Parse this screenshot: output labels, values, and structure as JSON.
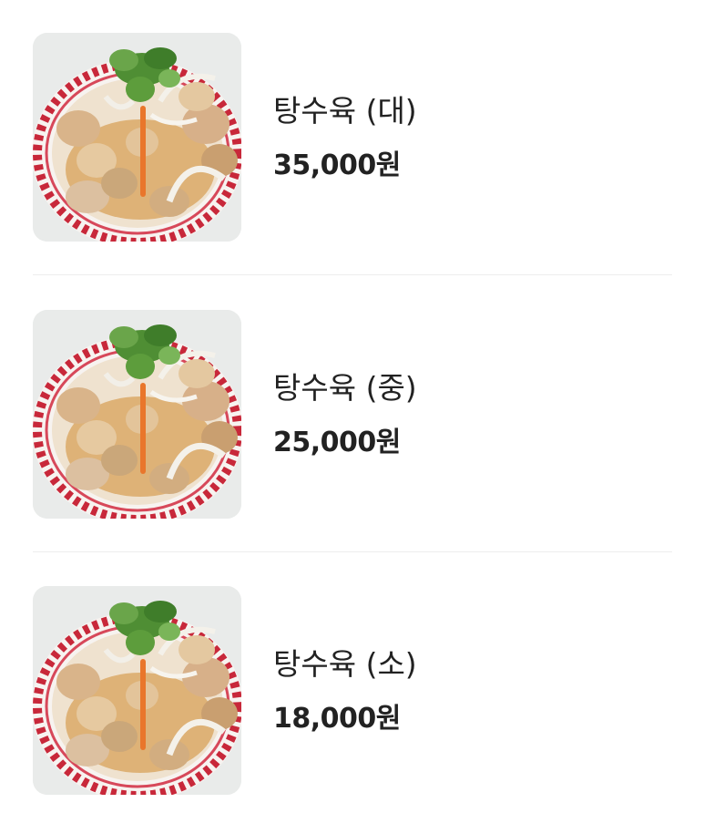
{
  "menu": {
    "items": [
      {
        "name": "탕수육 (대)",
        "price": "35,000원",
        "image": "sweet-and-sour-pork-photo"
      },
      {
        "name": "탕수육 (중)",
        "price": "25,000원",
        "image": "sweet-and-sour-pork-photo"
      },
      {
        "name": "탕수육 (소)",
        "price": "18,000원",
        "image": "sweet-and-sour-pork-photo"
      }
    ]
  },
  "colors": {
    "text": "#222222",
    "divider": "#ededed",
    "plate_rim": "#c8283a",
    "thumb_background": "#e9ebea"
  }
}
